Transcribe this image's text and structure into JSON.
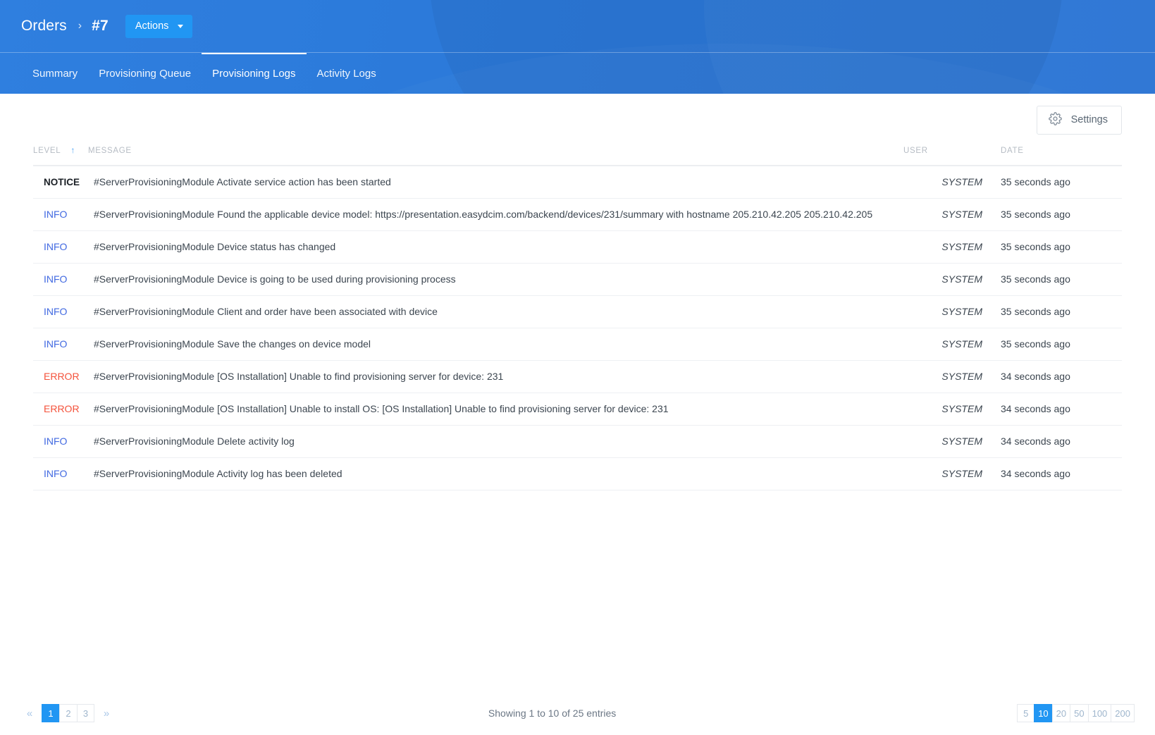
{
  "header": {
    "breadcrumb_root": "Orders",
    "breadcrumb_separator": "›",
    "breadcrumb_current": "#7",
    "actions_label": "Actions",
    "brand_color": "#2b79d9",
    "accent_color": "#2196f3",
    "tabs": [
      {
        "label": "Summary",
        "active": false
      },
      {
        "label": "Provisioning Queue",
        "active": false
      },
      {
        "label": "Provisioning Logs",
        "active": true
      },
      {
        "label": "Activity Logs",
        "active": false
      }
    ]
  },
  "toolbar": {
    "settings_label": "Settings",
    "settings_icon": "gear-icon"
  },
  "table": {
    "columns": [
      {
        "key": "level",
        "label": "LEVEL",
        "sorted": true,
        "sort_dir": "asc",
        "sort_glyph": "↑"
      },
      {
        "key": "message",
        "label": "MESSAGE",
        "sorted": false
      },
      {
        "key": "user",
        "label": "USER",
        "sorted": false
      },
      {
        "key": "date",
        "label": "DATE",
        "sorted": false
      }
    ],
    "level_colors": {
      "NOTICE": "#1b2026",
      "INFO": "#4169e1",
      "ERROR": "#f4523b"
    },
    "rows": [
      {
        "level": "NOTICE",
        "message": "#ServerProvisioningModule Activate service action has been started",
        "user": "SYSTEM",
        "date": "35 seconds ago"
      },
      {
        "level": "INFO",
        "message": "#ServerProvisioningModule Found the applicable device model: https://presentation.easydcim.com/backend/devices/231/summary with hostname 205.210.42.205 205.210.42.205",
        "user": "SYSTEM",
        "date": "35 seconds ago"
      },
      {
        "level": "INFO",
        "message": "#ServerProvisioningModule Device status has changed",
        "user": "SYSTEM",
        "date": "35 seconds ago"
      },
      {
        "level": "INFO",
        "message": "#ServerProvisioningModule Device is going to be used during provisioning process",
        "user": "SYSTEM",
        "date": "35 seconds ago"
      },
      {
        "level": "INFO",
        "message": "#ServerProvisioningModule Client and order have been associated with device",
        "user": "SYSTEM",
        "date": "35 seconds ago"
      },
      {
        "level": "INFO",
        "message": "#ServerProvisioningModule Save the changes on device model",
        "user": "SYSTEM",
        "date": "35 seconds ago"
      },
      {
        "level": "ERROR",
        "message": "#ServerProvisioningModule [OS Installation] Unable to find provisioning server for device: 231",
        "user": "SYSTEM",
        "date": "34 seconds ago"
      },
      {
        "level": "ERROR",
        "message": "#ServerProvisioningModule [OS Installation] Unable to install OS: [OS Installation] Unable to find provisioning server for device: 231",
        "user": "SYSTEM",
        "date": "34 seconds ago"
      },
      {
        "level": "INFO",
        "message": "#ServerProvisioningModule Delete activity log",
        "user": "SYSTEM",
        "date": "34 seconds ago"
      },
      {
        "level": "INFO",
        "message": "#ServerProvisioningModule Activity log has been deleted",
        "user": "SYSTEM",
        "date": "34 seconds ago"
      }
    ]
  },
  "footer": {
    "prev_glyph": "«",
    "next_glyph": "»",
    "pages": [
      "1",
      "2",
      "3"
    ],
    "active_page": "1",
    "status": "Showing 1 to 10 of 25 entries",
    "page_sizes": [
      "5",
      "10",
      "20",
      "50",
      "100",
      "200"
    ],
    "active_page_size": "10"
  }
}
